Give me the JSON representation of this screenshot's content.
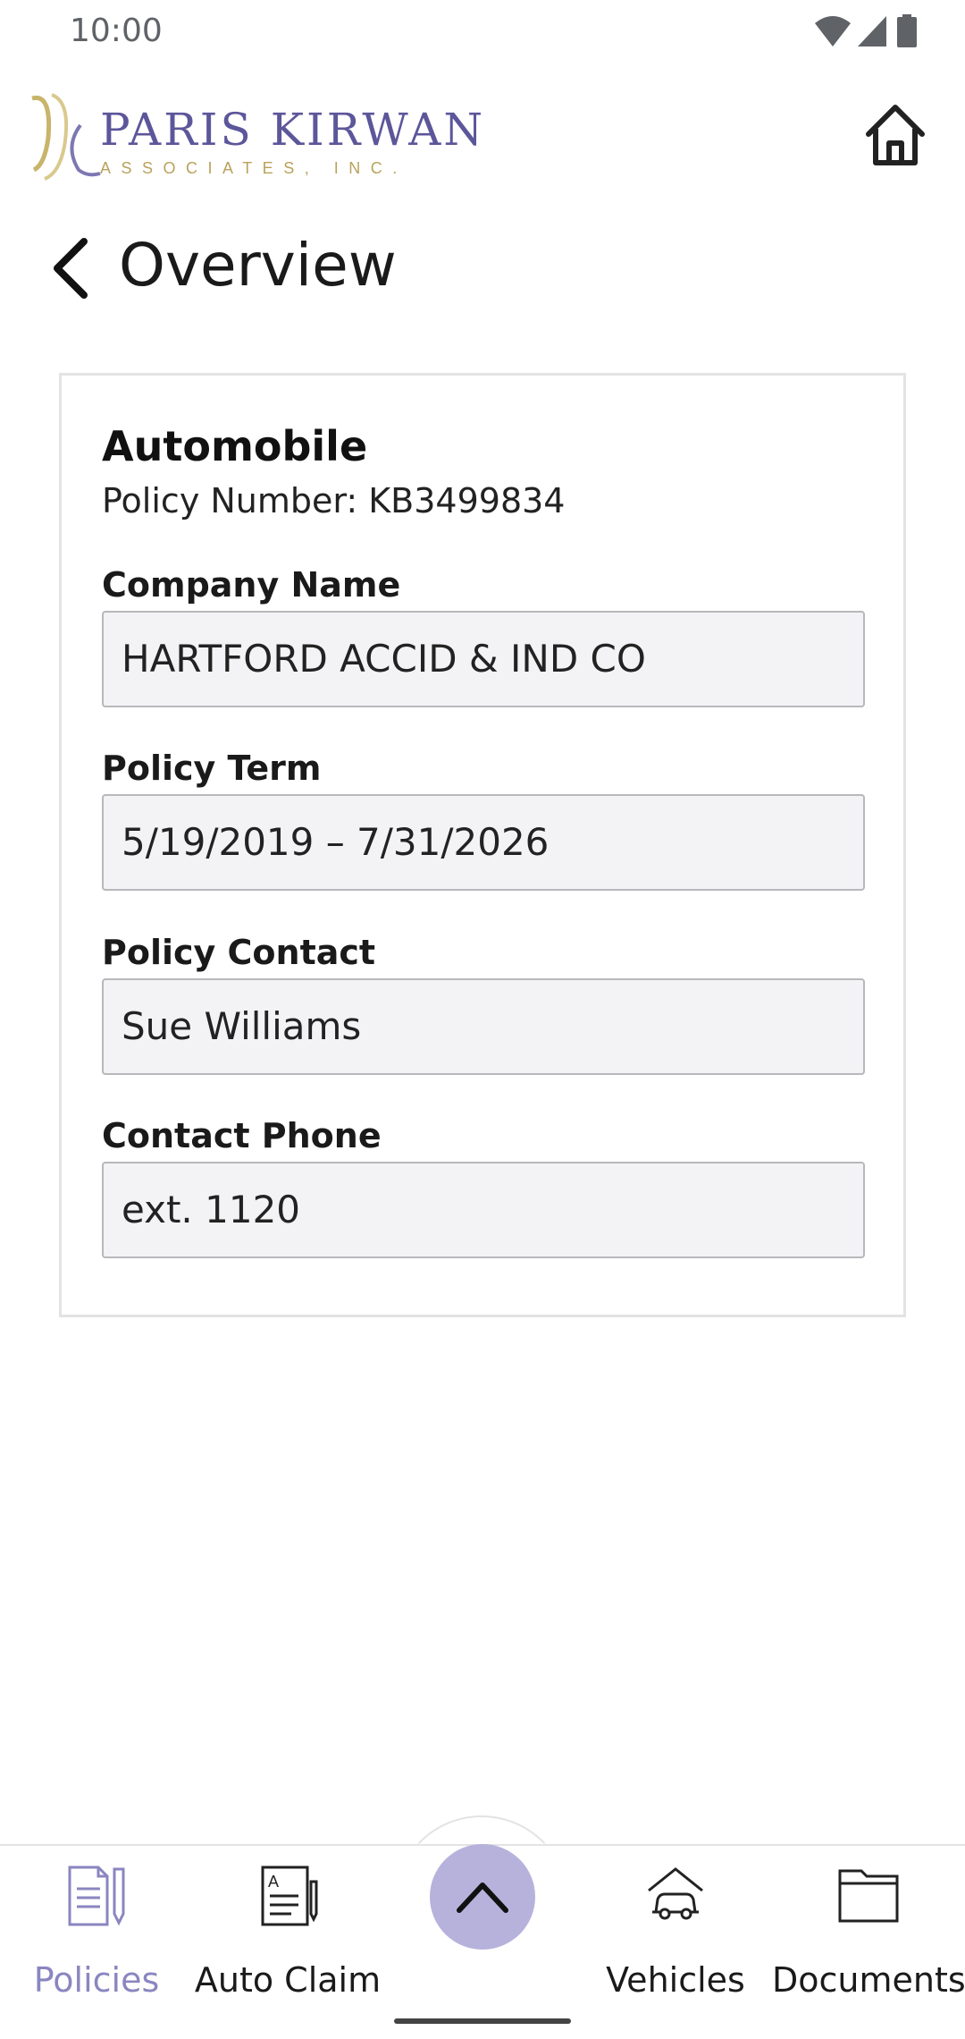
{
  "status_bar": {
    "time": "10:00",
    "icons": [
      "wifi-icon",
      "cellular-signal-icon",
      "battery-icon"
    ]
  },
  "header": {
    "logo_main": "PARIS KIRWAN",
    "logo_sub": "ASSOCIATES, INC.",
    "home_icon": "home-icon"
  },
  "page": {
    "title": "Overview",
    "back_icon": "chevron-left-icon"
  },
  "card": {
    "title": "Automobile",
    "policy_number_line": "Policy Number: KB3499834",
    "fields": [
      {
        "label": "Company Name",
        "value": "HARTFORD ACCID & IND CO"
      },
      {
        "label": "Policy Term",
        "value": "5/19/2019 – 7/31/2026"
      },
      {
        "label": "Policy Contact",
        "value": "Sue Williams"
      },
      {
        "label": "Contact Phone",
        "value": "ext. 1120"
      }
    ]
  },
  "bottom_nav": {
    "items": [
      {
        "label": "Policies",
        "icon": "policy-document-icon",
        "active": true
      },
      {
        "label": "Auto Claim",
        "icon": "claim-form-icon",
        "active": false
      },
      {
        "label": "Vehicles",
        "icon": "car-garage-icon",
        "active": false
      },
      {
        "label": "Documents",
        "icon": "folder-icon",
        "active": false
      }
    ],
    "center_button_icon": "chevron-up-icon"
  },
  "colors": {
    "accent": "#8a86c0",
    "fab": "#b7b2dc",
    "logo_purple": "#5c569a",
    "logo_gold": "#b9a25b",
    "field_bg": "#f3f3f5"
  }
}
